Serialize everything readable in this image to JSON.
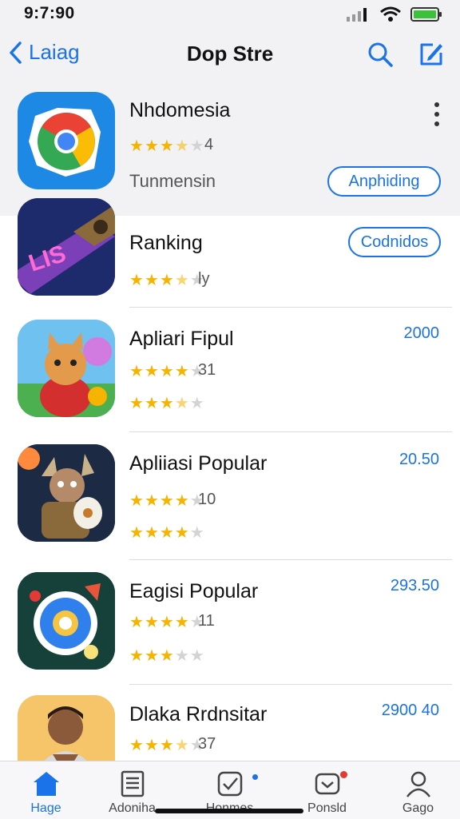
{
  "status": {
    "time": "9:7:90"
  },
  "nav": {
    "back_label": "Laiag",
    "title": "Dop Stre"
  },
  "featured": {
    "name": "Nhdomesia",
    "rating": 3.5,
    "rating_count": "4",
    "subtitle": "Tunmensin",
    "button_label": "Anphiding"
  },
  "apps": [
    {
      "name": "Ranking",
      "button_label": "Codnidos",
      "rating1": 3.5,
      "count1": "ly"
    },
    {
      "name": "Apliari Fipul",
      "price": "2000",
      "rating1": 4,
      "count1": "31",
      "rating2": 3.5
    },
    {
      "name": "Apliiasi Popular",
      "price": "20.50",
      "rating1": 4,
      "count1": "10",
      "rating2": 4
    },
    {
      "name": "Eagisi Popular",
      "price": "293.50",
      "rating1": 4,
      "count1": "11",
      "rating2": 3
    },
    {
      "name": "Dlaka Rrdnsitar",
      "price": "2900 40",
      "rating1": 3.5,
      "count1": "37"
    }
  ],
  "tabs": [
    {
      "label": "Hage",
      "icon": "home-icon",
      "active": true
    },
    {
      "label": "Adoniha",
      "icon": "document-icon"
    },
    {
      "label": "Honmes",
      "icon": "checkbox-icon",
      "badge_color": "#1a73e8"
    },
    {
      "label": "Ponsld",
      "icon": "inbox-icon",
      "badge_color": "#e53935"
    },
    {
      "label": "Gago",
      "icon": "person-icon"
    }
  ],
  "colors": {
    "accent": "#1a73e8",
    "star": "#f4b400"
  }
}
